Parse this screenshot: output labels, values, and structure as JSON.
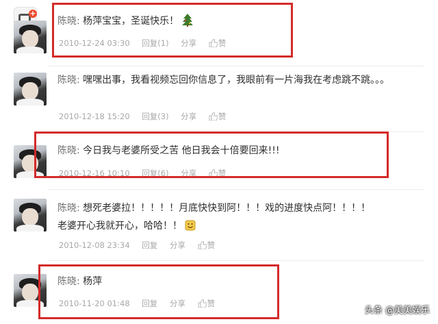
{
  "posts": [
    {
      "author": "陈晓:",
      "text": "杨萍宝宝，圣诞快乐！",
      "emoji": "christmas-tree-icon",
      "timestamp": "2010-12-24 03:30",
      "reply": "回复(1)",
      "share": "分享",
      "like": "赞",
      "highlighted": true
    },
    {
      "author": "陈晓:",
      "text": "嘿嘿出事，我看视频忘回你信息了，我眼前有一片海我在考虑跳不跳。。。",
      "timestamp": "2010-12-18 15:20",
      "reply": "回复(3)",
      "share": "分享",
      "like": "赞",
      "highlighted": false
    },
    {
      "author": "陈晓:",
      "text": "今日我与老婆所受之苦 他日我会十倍要回来!!!",
      "timestamp": "2010-12-16 10:10",
      "reply": "回复(6)",
      "share": "分享",
      "like": "赞",
      "highlighted": true
    },
    {
      "author": "陈晓:",
      "text": "想死老婆拉！！！！！月底快快到阿！！！戏的进度快点阿！！！！老婆开心我就开心，哈哈！！",
      "emoji": "smile-face-icon",
      "timestamp": "2010-12-08 23:34",
      "reply": "回复",
      "share": "分享",
      "like": "赞",
      "highlighted": false
    },
    {
      "author": "陈晓:",
      "text": "杨萍",
      "timestamp": "2010-11-20 01:48",
      "reply": "回复",
      "share": "分享",
      "like": "赞",
      "highlighted": true
    }
  ],
  "watermark": "头条 @美美娱乐",
  "colors": {
    "highlight": "#d42a2a",
    "meta": "#a8a8a8",
    "text": "#2f2f2f"
  }
}
